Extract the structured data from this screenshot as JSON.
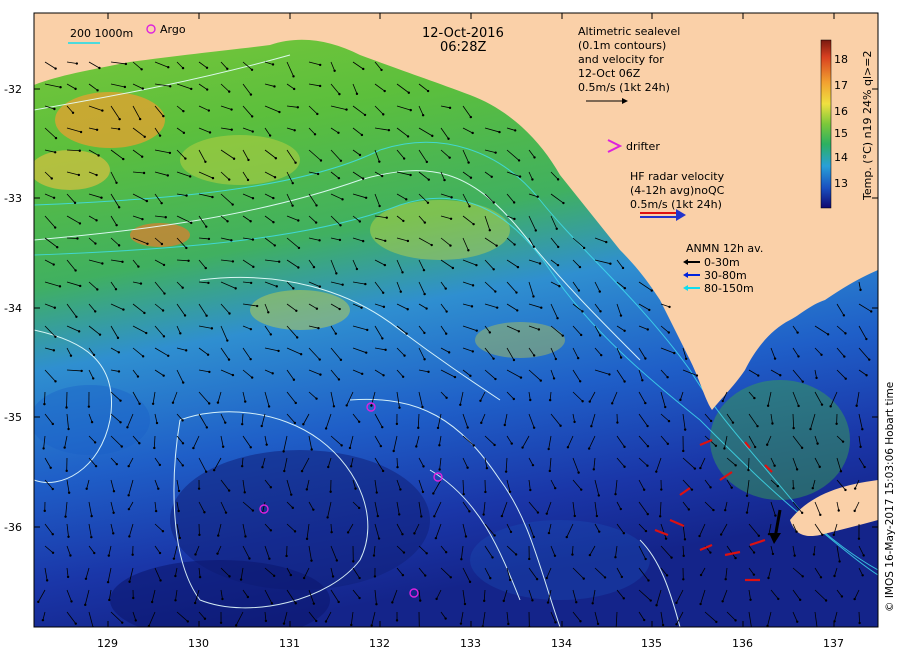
{
  "map": {
    "date": "12-Oct-2016",
    "time": "06:28Z",
    "lat_ticks": [
      "-32",
      "-33",
      "-34",
      "-35",
      "-36"
    ],
    "lon_ticks": [
      "129",
      "130",
      "131",
      "132",
      "133",
      "134",
      "135",
      "136",
      "137"
    ],
    "colorbar": {
      "label": "Temp. (°C) n19 24% ql>=2",
      "ticks": [
        "18",
        "17",
        "16",
        "15",
        "14",
        "13"
      ]
    },
    "legend": {
      "isobath": "200  1000m",
      "argo": "Argo",
      "altimetry_lines": [
        "Altimetric sealevel",
        "(0.1m contours)",
        "and velocity for",
        "12-Oct 06Z",
        "0.5m/s (1kt 24h)"
      ],
      "drifter": "drifter",
      "hf_lines": [
        "HF radar velocity",
        "(4-12h avg)noQC",
        "0.5m/s (1kt 24h)"
      ],
      "anmn_title": "ANMN 12h av.",
      "anmn_items": [
        "0-30m",
        "30-80m",
        "80-150m"
      ]
    },
    "credit": "© IMOS 16-May-2017 15:03:06 Hobart time",
    "colors": {
      "land": "#fad0a8",
      "argo": "#dd22dd",
      "hf_red": "#dd1111",
      "hf_blue": "#2233cc",
      "anmn_black": "#000000",
      "anmn_blue": "#0022dd",
      "anmn_cyan": "#11ddee",
      "contour": "#e8ffff"
    }
  }
}
